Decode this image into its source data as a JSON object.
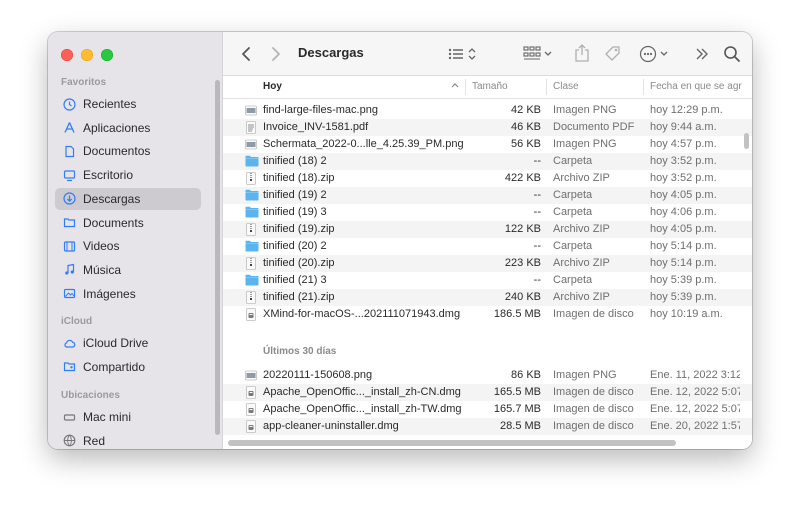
{
  "window": {
    "title": "Descargas"
  },
  "sidebar": {
    "sections": [
      {
        "label": "Favoritos",
        "items": [
          {
            "label": "Recientes",
            "icon": "clock-icon"
          },
          {
            "label": "Aplicaciones",
            "icon": "apps-icon"
          },
          {
            "label": "Documentos",
            "icon": "document-icon"
          },
          {
            "label": "Escritorio",
            "icon": "desktop-icon"
          },
          {
            "label": "Descargas",
            "icon": "download-icon",
            "active": true
          },
          {
            "label": "Documents",
            "icon": "folder-icon"
          },
          {
            "label": "Videos",
            "icon": "film-icon"
          },
          {
            "label": "Música",
            "icon": "music-icon"
          },
          {
            "label": "Imágenes",
            "icon": "photo-icon"
          }
        ]
      },
      {
        "label": "iCloud",
        "items": [
          {
            "label": "iCloud Drive",
            "icon": "cloud-icon"
          },
          {
            "label": "Compartido",
            "icon": "shared-folder-icon"
          }
        ]
      },
      {
        "label": "Ubicaciones",
        "items": [
          {
            "label": "Mac mini",
            "icon": "computer-icon"
          },
          {
            "label": "Red",
            "icon": "globe-icon"
          }
        ]
      }
    ]
  },
  "columns": {
    "name": "Hoy",
    "size": "Tamaño",
    "kind": "Clase",
    "date": "Fecha en que se agr"
  },
  "groups": [
    {
      "label": "",
      "files": [
        {
          "name": "find-large-files-mac.png",
          "size": "42 KB",
          "kind": "Imagen PNG",
          "date": "hoy 12:29 p.m.",
          "icon": "image-file-icon"
        },
        {
          "name": "Invoice_INV-1581.pdf",
          "size": "46 KB",
          "kind": "Documento PDF",
          "date": "hoy 9:44 a.m.",
          "icon": "pdf-file-icon"
        },
        {
          "name": "Schermata_2022-0...lle_4.25.39_PM.png",
          "size": "56 KB",
          "kind": "Imagen PNG",
          "date": "hoy 4:57 p.m.",
          "icon": "image-file-icon"
        },
        {
          "name": "tinified (18) 2",
          "size": "--",
          "kind": "Carpeta",
          "date": "hoy 3:52 p.m.",
          "icon": "folder-icon"
        },
        {
          "name": "tinified (18).zip",
          "size": "422 KB",
          "kind": "Archivo ZIP",
          "date": "hoy 3:52 p.m.",
          "icon": "zip-file-icon"
        },
        {
          "name": "tinified (19) 2",
          "size": "--",
          "kind": "Carpeta",
          "date": "hoy 4:05 p.m.",
          "icon": "folder-icon"
        },
        {
          "name": "tinified (19) 3",
          "size": "--",
          "kind": "Carpeta",
          "date": "hoy 4:06 p.m.",
          "icon": "folder-icon"
        },
        {
          "name": "tinified (19).zip",
          "size": "122 KB",
          "kind": "Archivo ZIP",
          "date": "hoy 4:05 p.m.",
          "icon": "zip-file-icon"
        },
        {
          "name": "tinified (20) 2",
          "size": "--",
          "kind": "Carpeta",
          "date": "hoy 5:14 p.m.",
          "icon": "folder-icon"
        },
        {
          "name": "tinified (20).zip",
          "size": "223 KB",
          "kind": "Archivo ZIP",
          "date": "hoy 5:14 p.m.",
          "icon": "zip-file-icon"
        },
        {
          "name": "tinified (21) 3",
          "size": "--",
          "kind": "Carpeta",
          "date": "hoy 5:39 p.m.",
          "icon": "folder-icon"
        },
        {
          "name": "tinified (21).zip",
          "size": "240 KB",
          "kind": "Archivo ZIP",
          "date": "hoy 5:39 p.m.",
          "icon": "zip-file-icon"
        },
        {
          "name": "XMind-for-macOS-...202111071943.dmg",
          "size": "186.5 MB",
          "kind": "Imagen de disco",
          "date": "hoy 10:19 a.m.",
          "icon": "disk-image-icon"
        }
      ]
    },
    {
      "label": "Últimos 30 días",
      "files": [
        {
          "name": "20220111-150608.png",
          "size": "86 KB",
          "kind": "Imagen PNG",
          "date": "Ene. 11, 2022 3:12",
          "icon": "image-file-icon"
        },
        {
          "name": "Apache_OpenOffic..._install_zh-CN.dmg",
          "size": "165.5 MB",
          "kind": "Imagen de disco",
          "date": "Ene. 12, 2022 5:07",
          "icon": "disk-image-icon"
        },
        {
          "name": "Apache_OpenOffic..._install_zh-TW.dmg",
          "size": "165.7 MB",
          "kind": "Imagen de disco",
          "date": "Ene. 12, 2022 5:07",
          "icon": "disk-image-icon"
        },
        {
          "name": "app-cleaner-uninstaller.dmg",
          "size": "28.5 MB",
          "kind": "Imagen de disco",
          "date": "Ene. 20, 2022 1:57",
          "icon": "disk-image-icon"
        }
      ]
    }
  ],
  "colors": {
    "folder": "#5ab4f0",
    "sidebar_bg": "#e6e4e9",
    "sidebar_active": "#cdcbd0",
    "icon_blue": "#2f7ef5"
  }
}
